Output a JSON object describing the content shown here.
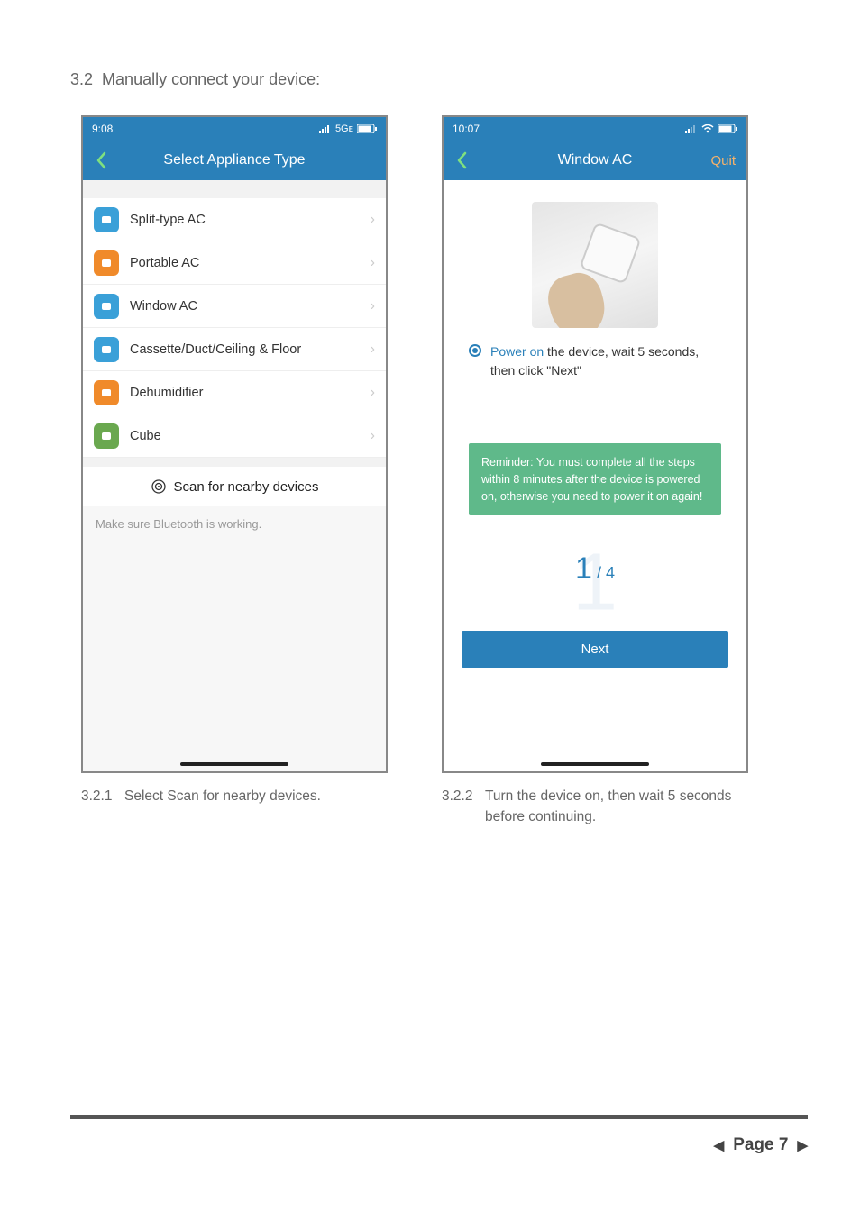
{
  "section": {
    "number": "3.2",
    "title": "Manually connect your device:"
  },
  "screenA": {
    "status_time": "9:08",
    "status_net": "5Gᴇ",
    "nav_title": "Select Appliance Type",
    "items": [
      {
        "label": "Split-type AC",
        "icon_color": "#3aa0d8",
        "icon_name": "split-ac-icon"
      },
      {
        "label": "Portable AC",
        "icon_color": "#f08a2a",
        "icon_name": "portable-ac-icon"
      },
      {
        "label": "Window AC",
        "icon_color": "#3aa0d8",
        "icon_name": "window-ac-icon"
      },
      {
        "label": "Cassette/Duct/Ceiling & Floor",
        "icon_color": "#3aa0d8",
        "icon_name": "cassette-ac-icon"
      },
      {
        "label": "Dehumidifier",
        "icon_color": "#f08a2a",
        "icon_name": "dehumidifier-icon"
      },
      {
        "label": "Cube",
        "icon_color": "#6aa84f",
        "icon_name": "cube-icon"
      }
    ],
    "scan_label": "Scan for nearby devices",
    "bt_hint": "Make sure Bluetooth is working."
  },
  "screenB": {
    "status_time": "10:07",
    "nav_title": "Window AC",
    "quit_label": "Quit",
    "instruction_highlight": "Power on",
    "instruction_rest": " the device, wait 5 seconds, then click \"Next\"",
    "reminder": "Reminder: You must complete all the steps within 8 minutes after the device is powered on, otherwise you need  to power it on again!",
    "step_current": "1",
    "step_total": "4",
    "next_label": "Next"
  },
  "captions": {
    "a_num": "3.2.1",
    "a_text": "Select Scan for nearby devices.",
    "b_num": "3.2.2",
    "b_text": "Turn the device on, then wait 5 seconds before continuing."
  },
  "footer": {
    "page_label": "Page 7"
  }
}
